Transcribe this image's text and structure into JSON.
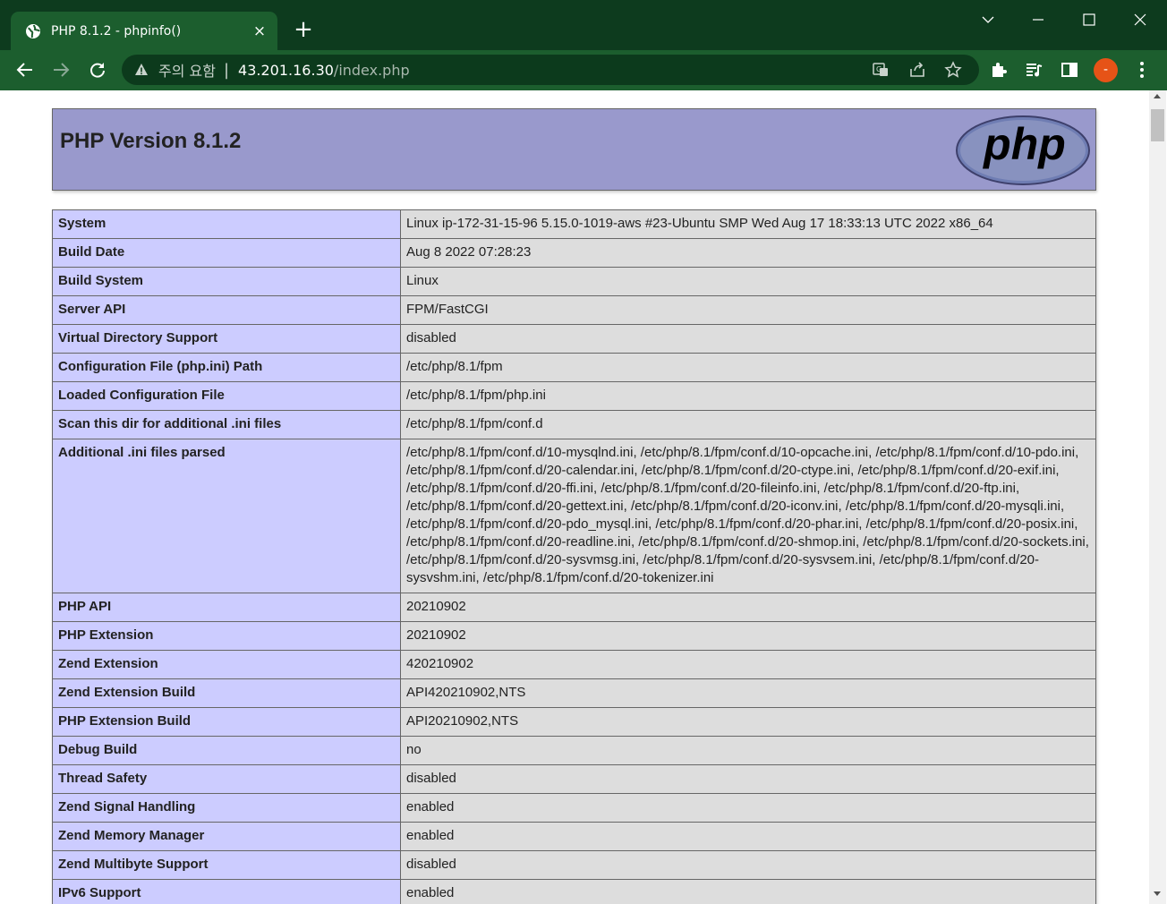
{
  "browser": {
    "tab_title": "PHP 8.1.2 - phpinfo()",
    "tab_close": "×",
    "new_tab": "+",
    "security_label": "주의 요함",
    "separator": "|",
    "url_host": "43.201.16.30",
    "url_path": "/index.php",
    "profile_label": "-",
    "profile_color": "#e65317",
    "frame_color": "#0d3b1e",
    "toolbar_color": "#1c5e2e",
    "icons": {
      "tab": "globe-icon",
      "window": [
        "chevron-down-icon",
        "minimize-icon",
        "maximize-icon",
        "close-icon"
      ],
      "nav": [
        "back-icon",
        "forward-icon",
        "reload-icon"
      ],
      "omnibox": [
        "warning-icon",
        "translate-icon",
        "share-icon",
        "bookmark-star-icon"
      ],
      "extensions": [
        "extensions-puzzle-icon",
        "media-playlist-icon",
        "side-panel-icon"
      ],
      "menu": "kebab-menu-icon"
    }
  },
  "page": {
    "version_title": "PHP Version 8.1.2",
    "logo_text": "php",
    "header_color": "#9999cc",
    "key_cell_color": "#ccccff",
    "value_cell_color": "#dddddd",
    "rows": [
      {
        "key": "System",
        "value": "Linux ip-172-31-15-96 5.15.0-1019-aws #23-Ubuntu SMP Wed Aug 17 18:33:13 UTC 2022 x86_64"
      },
      {
        "key": "Build Date",
        "value": "Aug 8 2022 07:28:23"
      },
      {
        "key": "Build System",
        "value": "Linux"
      },
      {
        "key": "Server API",
        "value": "FPM/FastCGI"
      },
      {
        "key": "Virtual Directory Support",
        "value": "disabled"
      },
      {
        "key": "Configuration File (php.ini) Path",
        "value": "/etc/php/8.1/fpm"
      },
      {
        "key": "Loaded Configuration File",
        "value": "/etc/php/8.1/fpm/php.ini"
      },
      {
        "key": "Scan this dir for additional .ini files",
        "value": "/etc/php/8.1/fpm/conf.d"
      },
      {
        "key": "Additional .ini files parsed",
        "value": "/etc/php/8.1/fpm/conf.d/10-mysqlnd.ini, /etc/php/8.1/fpm/conf.d/10-opcache.ini, /etc/php/8.1/fpm/conf.d/10-pdo.ini, /etc/php/8.1/fpm/conf.d/20-calendar.ini, /etc/php/8.1/fpm/conf.d/20-ctype.ini, /etc/php/8.1/fpm/conf.d/20-exif.ini, /etc/php/8.1/fpm/conf.d/20-ffi.ini, /etc/php/8.1/fpm/conf.d/20-fileinfo.ini, /etc/php/8.1/fpm/conf.d/20-ftp.ini, /etc/php/8.1/fpm/conf.d/20-gettext.ini, /etc/php/8.1/fpm/conf.d/20-iconv.ini, /etc/php/8.1/fpm/conf.d/20-mysqli.ini, /etc/php/8.1/fpm/conf.d/20-pdo_mysql.ini, /etc/php/8.1/fpm/conf.d/20-phar.ini, /etc/php/8.1/fpm/conf.d/20-posix.ini, /etc/php/8.1/fpm/conf.d/20-readline.ini, /etc/php/8.1/fpm/conf.d/20-shmop.ini, /etc/php/8.1/fpm/conf.d/20-sockets.ini, /etc/php/8.1/fpm/conf.d/20-sysvmsg.ini, /etc/php/8.1/fpm/conf.d/20-sysvsem.ini, /etc/php/8.1/fpm/conf.d/20-sysvshm.ini, /etc/php/8.1/fpm/conf.d/20-tokenizer.ini"
      },
      {
        "key": "PHP API",
        "value": "20210902"
      },
      {
        "key": "PHP Extension",
        "value": "20210902"
      },
      {
        "key": "Zend Extension",
        "value": "420210902"
      },
      {
        "key": "Zend Extension Build",
        "value": "API420210902,NTS"
      },
      {
        "key": "PHP Extension Build",
        "value": "API20210902,NTS"
      },
      {
        "key": "Debug Build",
        "value": "no"
      },
      {
        "key": "Thread Safety",
        "value": "disabled"
      },
      {
        "key": "Zend Signal Handling",
        "value": "enabled"
      },
      {
        "key": "Zend Memory Manager",
        "value": "enabled"
      },
      {
        "key": "Zend Multibyte Support",
        "value": "disabled"
      },
      {
        "key": "IPv6 Support",
        "value": "enabled"
      }
    ]
  }
}
